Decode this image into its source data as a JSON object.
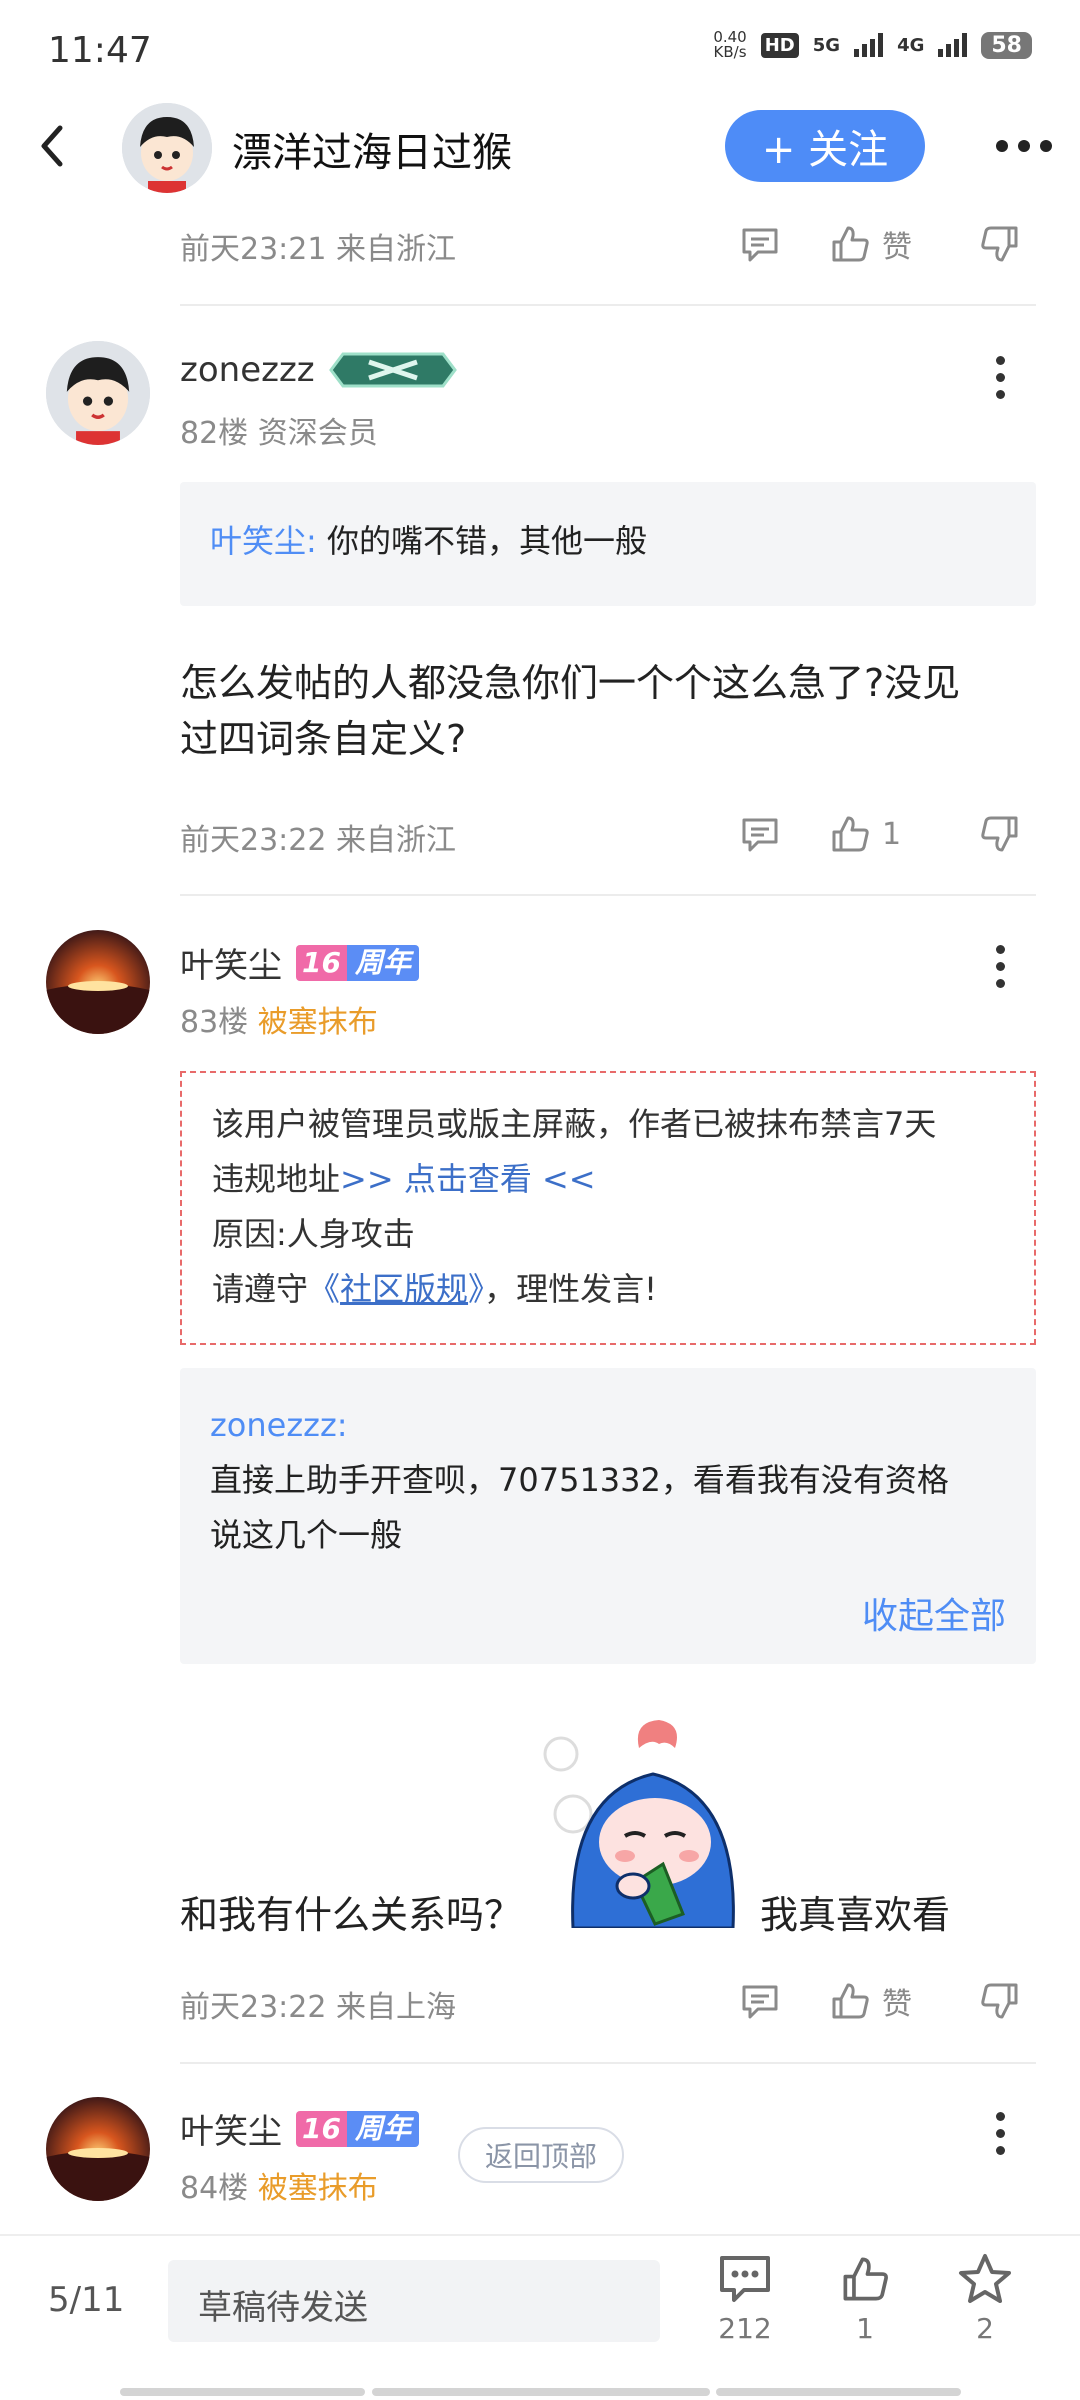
{
  "status_bar": {
    "time": "11:47",
    "net_speed_top": "0.40",
    "net_speed_unit": "KB/s",
    "hd_label": "HD",
    "net1": "5G",
    "net2": "4G",
    "battery": "58"
  },
  "nav": {
    "title": "漂洋过海日过猴",
    "follow_label": "+ 关注"
  },
  "posts": {
    "p0": {
      "meta": "前天23:21 来自浙江",
      "like_label": "赞"
    },
    "p82": {
      "username": "zonezzz",
      "floor": "82楼",
      "role": "资深会员",
      "quote_name": "叶笑尘:",
      "quote_text": "你的嘴不错，其他一般",
      "body_line1": "怎么发帖的人都没急你们一个个这么急了?没见",
      "body_line2": "过四词条自定义?",
      "meta": "前天23:22 来自浙江",
      "like_count": "1"
    },
    "p83": {
      "username": "叶笑尘",
      "badge_num": "16",
      "badge_text": "周年",
      "floor": "83楼",
      "role": "被塞抹布",
      "ban_line1": "该用户被管理员或版主屏蔽，作者已被抹布禁言7天",
      "ban_line2_prefix": "违规地址",
      "ban_line2_link": ">> 点击查看 <<",
      "ban_line3": "原因:人身攻击",
      "ban_line4_prefix": "请遵守",
      "ban_line4_open": "《",
      "ban_line4_link": "社区版规",
      "ban_line4_close": "》",
      "ban_line4_suffix": "，理性发言!",
      "quote_name": "zonezzz:",
      "quote_line1": "直接上助手开查呗，70751332，看看我有没有资格",
      "quote_line2": "说这几个一般",
      "collapse_label": "收起全部",
      "body_left": "和我有什么关系吗？",
      "body_right": "我真喜欢看",
      "meta": "前天23:22 来自上海",
      "like_label": "赞"
    },
    "p84": {
      "username": "叶笑尘",
      "badge_num": "16",
      "badge_text": "周年",
      "floor": "84楼",
      "role": "被塞抹布"
    }
  },
  "back_to_top": "返回顶部",
  "bottom_bar": {
    "page": "5/11",
    "draft_placeholder": "草稿待发送",
    "comment_count": "212",
    "like_count": "1",
    "star_count": "2"
  },
  "colors": {
    "accent_blue": "#4e8cf7",
    "role_orange": "#e99c2a",
    "ban_border": "#e86a6a",
    "quote_name": "#4f8df5"
  }
}
